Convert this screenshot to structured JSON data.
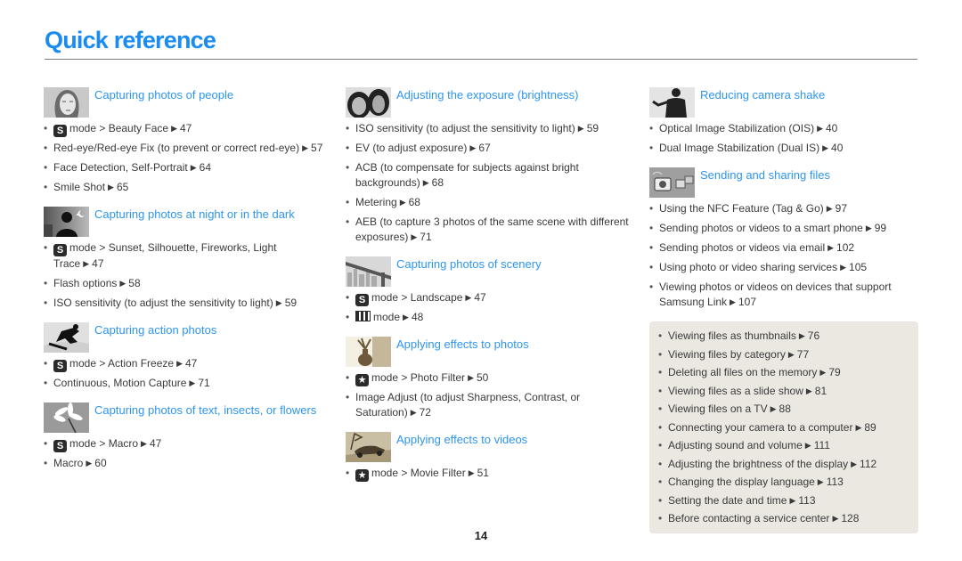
{
  "page": {
    "title": "Quick reference",
    "page_number": "14",
    "accent_color": "#1a8cf0"
  },
  "column1": [
    {
      "title": "Capturing photos of people",
      "thumb": "portrait-woman",
      "items": [
        {
          "mode_icon": "S",
          "text": "mode > Beauty Face",
          "page": "47"
        },
        {
          "text": "Red-eye/Red-eye Fix (to prevent or correct red-eye)",
          "page": "57"
        },
        {
          "text": "Face Detection, Self-Portrait",
          "page": "64"
        },
        {
          "text": "Smile Shot",
          "page": "65"
        }
      ]
    },
    {
      "title": "Capturing photos at night or in the dark",
      "thumb": "night-silhouette",
      "items": [
        {
          "mode_icon": "S",
          "text": "mode > Sunset, Silhouette, Fireworks, Light Trace",
          "page": "47"
        },
        {
          "text": "Flash options",
          "page": "58"
        },
        {
          "text": "ISO sensitivity (to adjust the sensitivity to light)",
          "page": "59"
        }
      ]
    },
    {
      "title": "Capturing action photos",
      "thumb": "snowboarder",
      "items": [
        {
          "mode_icon": "S",
          "text": "mode > Action Freeze",
          "page": "47"
        },
        {
          "text": "Continuous, Motion Capture",
          "page": "71"
        }
      ]
    },
    {
      "title": "Capturing photos of text, insects, or flowers",
      "thumb": "flower",
      "items": [
        {
          "mode_icon": "S",
          "text": "mode > Macro",
          "page": "47"
        },
        {
          "text": "Macro",
          "page": "60"
        }
      ]
    }
  ],
  "column2": [
    {
      "title": "Adjusting the exposure (brightness)",
      "thumb": "two-faces",
      "items": [
        {
          "text": "ISO sensitivity (to adjust the sensitivity to light)",
          "page": "59"
        },
        {
          "text": "EV (to adjust exposure)",
          "page": "67"
        },
        {
          "text": "ACB (to compensate for subjects against bright backgrounds)",
          "page": "68"
        },
        {
          "text": "Metering",
          "page": "68"
        },
        {
          "text": "AEB (to capture 3 photos of the same scene with different exposures)",
          "page": "71"
        }
      ]
    },
    {
      "title": "Capturing photos of scenery",
      "thumb": "bridge-city",
      "items": [
        {
          "mode_icon": "S",
          "text": "mode > Landscape",
          "page": "47"
        },
        {
          "mode_icon": "pano",
          "text": "mode",
          "page": "48"
        }
      ]
    },
    {
      "title": "Applying effects to photos",
      "thumb": "vase",
      "items": [
        {
          "mode_icon": "★",
          "text": "mode > Photo Filter",
          "page": "50"
        },
        {
          "text": "Image Adjust (to adjust Sharpness, Contrast, or Saturation)",
          "page": "72"
        }
      ]
    },
    {
      "title": "Applying effects to videos",
      "thumb": "race-car",
      "items": [
        {
          "mode_icon": "★",
          "text": "mode > Movie Filter",
          "page": "51"
        }
      ]
    }
  ],
  "column3": [
    {
      "title": "Reducing camera shake",
      "thumb": "man-silhouette",
      "items": [
        {
          "text": "Optical Image Stabilization (OIS)",
          "page": "40"
        },
        {
          "text": "Dual Image Stabilization (Dual IS)",
          "page": "40"
        }
      ]
    },
    {
      "title": "Sending and sharing files",
      "thumb": "camera-sharing",
      "items": [
        {
          "text": "Using the NFC Feature (Tag & Go)",
          "page": "97"
        },
        {
          "text": "Sending photos or videos to a smart phone",
          "page": "99"
        },
        {
          "text": "Sending photos or videos via email",
          "page": "102"
        },
        {
          "text": "Using photo or video sharing services",
          "page": "105"
        },
        {
          "text": "Viewing photos or videos on devices that support Samsung Link",
          "page": "107"
        }
      ]
    }
  ],
  "boxed_list": [
    {
      "text": "Viewing files as thumbnails",
      "page": "76"
    },
    {
      "text": "Viewing files by category",
      "page": "77"
    },
    {
      "text": "Deleting all files on the memory",
      "page": "79"
    },
    {
      "text": "Viewing files as a slide show",
      "page": "81"
    },
    {
      "text": "Viewing files on a TV",
      "page": "88"
    },
    {
      "text": "Connecting your camera to a computer",
      "page": "89"
    },
    {
      "text": "Adjusting sound and volume",
      "page": "111"
    },
    {
      "text": "Adjusting the brightness of the display",
      "page": "112"
    },
    {
      "text": "Changing the display language",
      "page": "113"
    },
    {
      "text": "Setting the date and time",
      "page": "113"
    },
    {
      "text": "Before contacting a service center",
      "page": "128"
    }
  ],
  "arrow_glyph": "▶"
}
